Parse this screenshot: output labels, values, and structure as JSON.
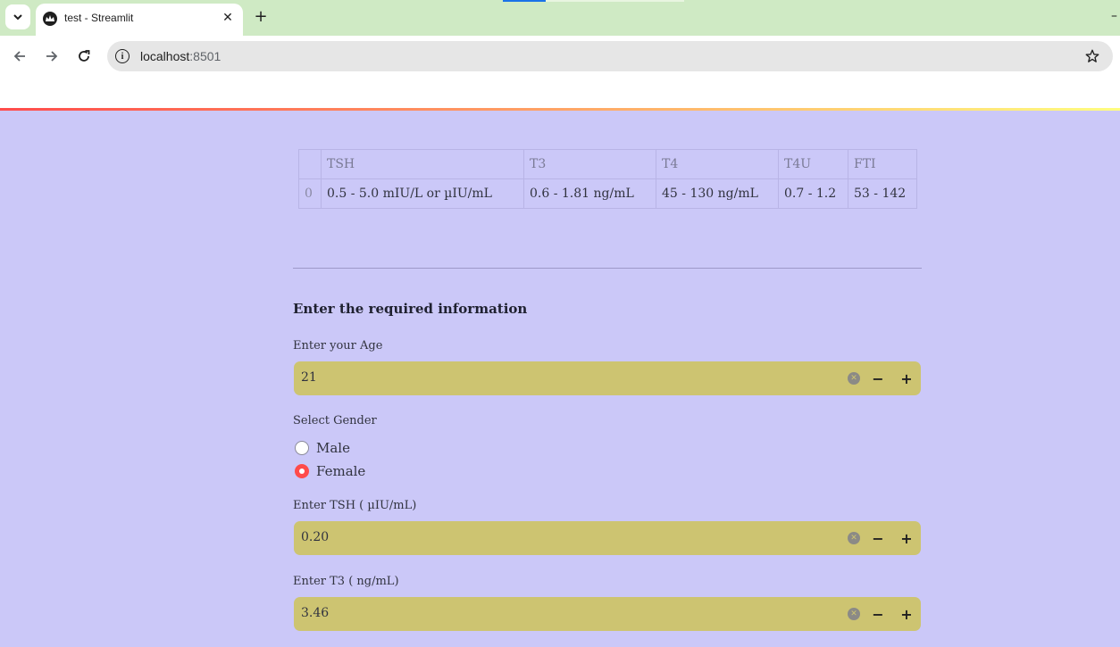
{
  "browser": {
    "tab_title": "test - Streamlit",
    "tab_close": "✕",
    "new_tab": "+",
    "url_host": "localhost",
    "url_port": ":8501",
    "icons": [
      "tab-list-icon",
      "streamlit-favicon",
      "back-icon",
      "forward-icon",
      "reload-icon",
      "site-info-icon",
      "bookmark-star-icon"
    ]
  },
  "ranges_table": {
    "columns": [
      "",
      "TSH",
      "T3",
      "T4",
      "T4U",
      "FTI"
    ],
    "rows": [
      {
        "index": "0",
        "tsh": "0.5 - 5.0 mIU/L or µIU/mL",
        "t3": "0.6 - 1.81 ng/mL",
        "t4": "45 - 130 ng/mL",
        "t4u": "0.7 - 1.2",
        "fti": "53 - 142"
      }
    ]
  },
  "form": {
    "title": "Enter the required information",
    "age": {
      "label": "Enter your Age",
      "value": "21"
    },
    "gender": {
      "label": "Select Gender",
      "options": [
        "Male",
        "Female"
      ],
      "selected": "Female"
    },
    "tsh": {
      "label": "Enter TSH ( µIU/mL)",
      "value": "0.20"
    },
    "t3": {
      "label": "Enter T3 ( ng/mL)",
      "value": "3.46"
    },
    "stepper_minus": "−",
    "stepper_plus": "+",
    "clear_glyph": "✕"
  },
  "colors": {
    "page_bg": "#cbc8f8",
    "input_bg": "#cdc471",
    "accent": "#ff4b4b",
    "tabbar_bg": "#cfeac4"
  }
}
